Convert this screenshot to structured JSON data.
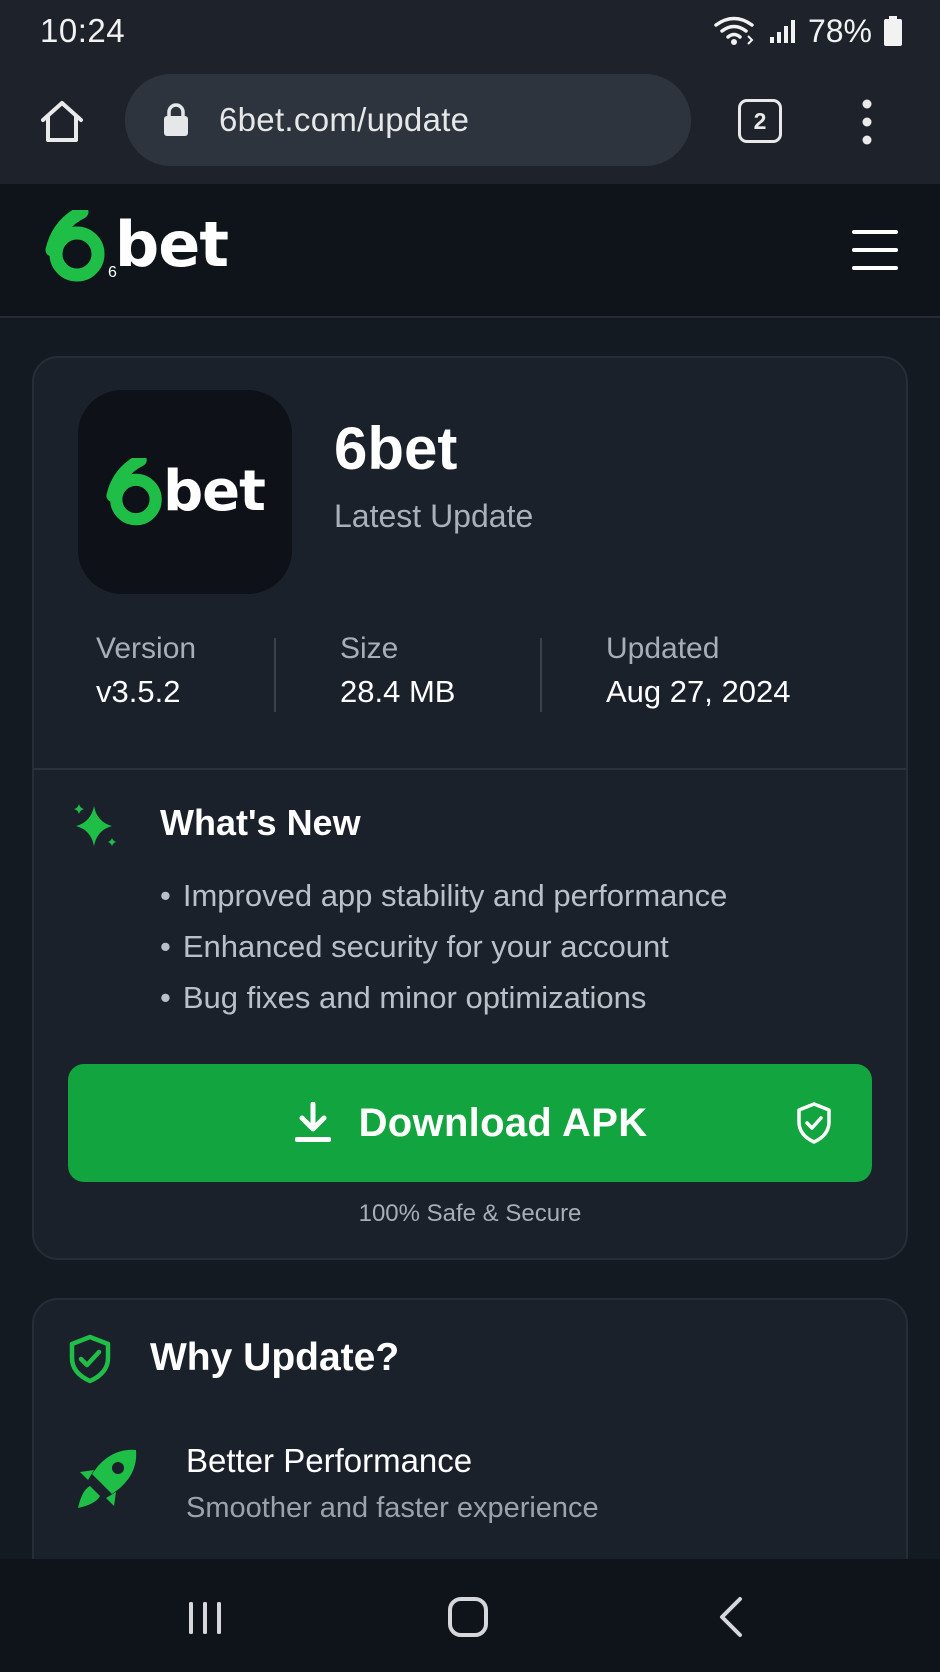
{
  "status_bar": {
    "time": "10:24",
    "battery": "78%",
    "icons": [
      "wifi-icon",
      "signal-icon",
      "battery-icon"
    ]
  },
  "browser": {
    "url": "6bet.com/update",
    "tab_count": "2",
    "icons": [
      "home-icon",
      "lock-icon",
      "tabs-icon",
      "more-vert-icon"
    ]
  },
  "site_header": {
    "logo_digit": "6",
    "logo_text": "bet",
    "menu_icon": "hamburger-icon"
  },
  "app_card": {
    "icon_logo_digit": "6",
    "icon_logo_text": "bet",
    "app_name": "6bet",
    "subtitle": "Latest Update",
    "stats": [
      {
        "label": "Version",
        "value": "v3.5.2"
      },
      {
        "label": "Size",
        "value": "28.4 MB"
      },
      {
        "label": "Updated",
        "value": "Aug 27, 2024"
      }
    ],
    "whats_new": {
      "title": "What's New",
      "items": [
        "Improved app stability and performance",
        "Enhanced security for your account",
        "Bug fixes and minor optimizations"
      ]
    },
    "download_label": "Download APK",
    "safe_text": "100% Safe & Secure"
  },
  "why_update": {
    "title": "Why Update?",
    "features": [
      {
        "title": "Better Performance",
        "subtitle": "Smoother and faster experience"
      }
    ]
  },
  "colors": {
    "accent": "#12a43e",
    "logo_green": "#1fbf47",
    "background": "#141a22",
    "card": "#1b212b"
  },
  "nav_bar": {
    "icons": [
      "recents-icon",
      "home-button-icon",
      "back-icon"
    ]
  }
}
